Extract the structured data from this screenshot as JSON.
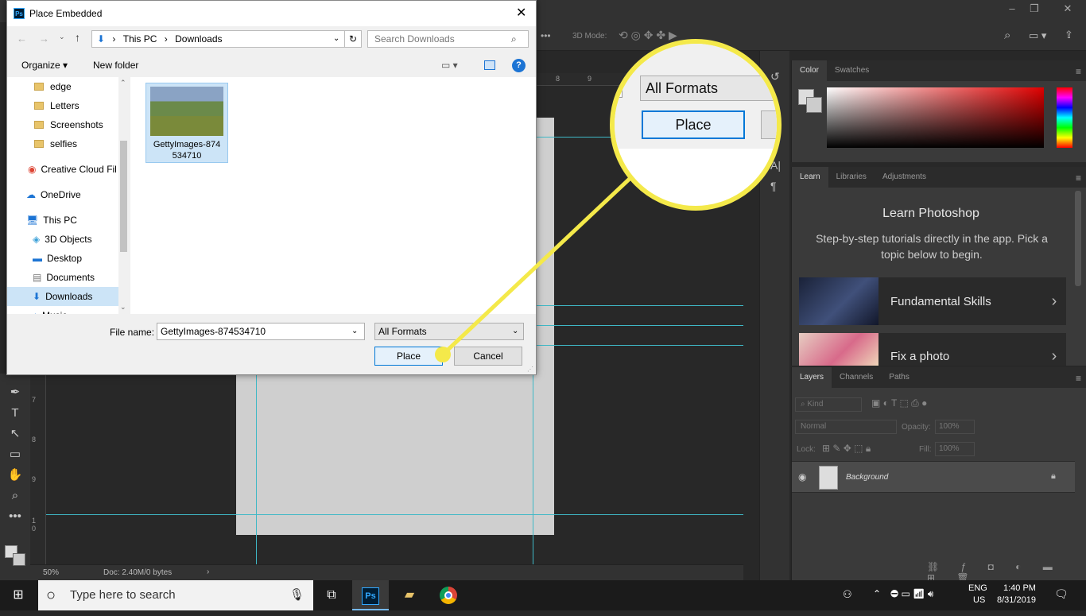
{
  "ps": {
    "options_bar": {
      "mode_label": "3D Mode:",
      "more": "•••"
    },
    "status": {
      "zoom": "50%",
      "doc": "Doc: 2.40M/0 bytes"
    },
    "ruler_left": [
      "7",
      "8",
      "9",
      "1",
      "0"
    ],
    "ruler_top": [
      "8",
      "9"
    ],
    "panels": {
      "color_tabs": [
        "Color",
        "Swatches"
      ],
      "learn_tabs": [
        "Learn",
        "Libraries",
        "Adjustments"
      ],
      "learn_title": "Learn Photoshop",
      "learn_desc": "Step-by-step tutorials directly in the app. Pick a topic below to begin.",
      "cards": [
        "Fundamental Skills",
        "Fix a photo"
      ],
      "layers_tabs": [
        "Layers",
        "Channels",
        "Paths"
      ],
      "kind": "Kind",
      "blend": "Normal",
      "opacity_label": "Opacity:",
      "opacity_value": "100%",
      "lock_label": "Lock:",
      "fill_label": "Fill:",
      "fill_value": "100%",
      "layer_name": "Background"
    }
  },
  "dialog": {
    "app_icon": "Ps",
    "title": "Place Embedded",
    "breadcrumb": [
      "This PC",
      "Downloads"
    ],
    "search_placeholder": "Search Downloads",
    "organize": "Organize ▾",
    "new_folder": "New folder",
    "nav_items": [
      {
        "label": "edge",
        "icon": "folder"
      },
      {
        "label": "Letters",
        "icon": "folder"
      },
      {
        "label": "Screenshots",
        "icon": "folder"
      },
      {
        "label": "selfies",
        "icon": "folder"
      },
      {
        "label": "Creative Cloud Fil",
        "icon": "cc"
      },
      {
        "label": "OneDrive",
        "icon": "cloud"
      },
      {
        "label": "This PC",
        "icon": "pc"
      },
      {
        "label": "3D Objects",
        "icon": "cube"
      },
      {
        "label": "Desktop",
        "icon": "desktop"
      },
      {
        "label": "Documents",
        "icon": "doc"
      },
      {
        "label": "Downloads",
        "icon": "download"
      },
      {
        "label": "Music",
        "icon": "music"
      }
    ],
    "file_name_line1": "GettyImages-874",
    "file_name_line2": "534710",
    "filename_label": "File name:",
    "filename_value": "GettyImages-874534710",
    "format": "All Formats",
    "place": "Place",
    "cancel": "Cancel"
  },
  "magnifier": {
    "format": "All Formats",
    "place": "Place"
  },
  "taskbar": {
    "search_placeholder": "Type here to search",
    "lang1": "ENG",
    "lang2": "US",
    "time": "1:40 PM",
    "date": "8/31/2019"
  },
  "colors": {
    "highlight": "#f4e94a",
    "guide": "#3fb8c6"
  }
}
